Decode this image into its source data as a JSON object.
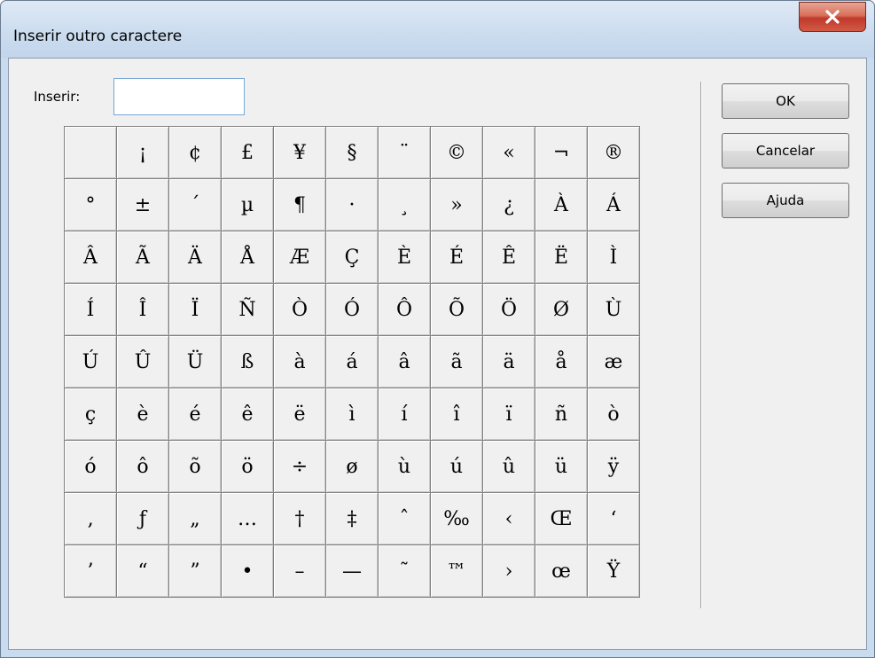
{
  "window": {
    "title": "Inserir outro caractere"
  },
  "insert": {
    "label": "Inserir:",
    "value": ""
  },
  "buttons": {
    "ok": "OK",
    "cancel": "Cancelar",
    "help": "Ajuda"
  },
  "characters": [
    " ",
    "¡",
    "¢",
    "£",
    "¥",
    "§",
    "¨",
    "©",
    "«",
    "¬",
    "®",
    "°",
    "±",
    "´",
    "µ",
    "¶",
    "·",
    "¸",
    "»",
    "¿",
    "À",
    "Á",
    "Â",
    "Ã",
    "Ä",
    "Å",
    "Æ",
    "Ç",
    "È",
    "É",
    "Ê",
    "Ë",
    "Ì",
    "Í",
    "Î",
    "Ï",
    "Ñ",
    "Ò",
    "Ó",
    "Ô",
    "Õ",
    "Ö",
    "Ø",
    "Ù",
    "Ú",
    "Û",
    "Ü",
    "ß",
    "à",
    "á",
    "â",
    "ã",
    "ä",
    "å",
    "æ",
    "ç",
    "è",
    "é",
    "ê",
    "ë",
    "ì",
    "í",
    "î",
    "ï",
    "ñ",
    "ò",
    "ó",
    "ô",
    "õ",
    "ö",
    "÷",
    "ø",
    "ù",
    "ú",
    "û",
    "ü",
    "ÿ",
    "‚",
    "ƒ",
    "„",
    "…",
    "†",
    "‡",
    "ˆ",
    "‰",
    "‹",
    "Œ",
    "‘",
    "’",
    "“",
    "”",
    "•",
    "–",
    "—",
    "˜",
    "™",
    "›",
    "œ",
    "Ÿ"
  ]
}
